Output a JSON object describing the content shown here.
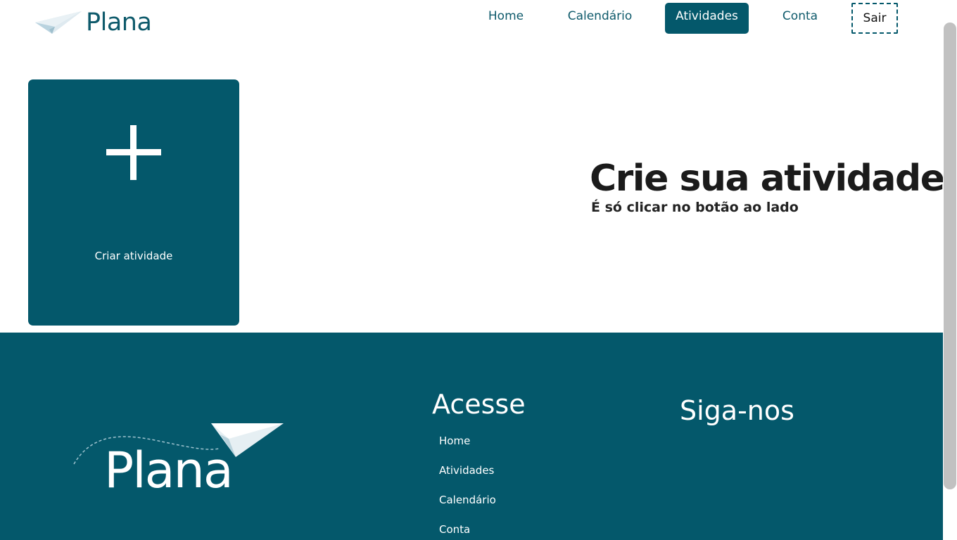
{
  "header": {
    "logo_text": "Plana",
    "nav": {
      "home": "Home",
      "calendario": "Calendário",
      "atividades": "Atividades",
      "conta": "Conta",
      "sair": "Sair"
    }
  },
  "main": {
    "create_card_label": "Criar atividade",
    "hero_title": "Crie sua atividade!",
    "hero_subtitle": "É só clicar no botão ao lado"
  },
  "footer": {
    "logo_text": "Plana",
    "acesse_title": "Acesse",
    "links": [
      "Home",
      "Atividades",
      "Calendário",
      "Conta"
    ],
    "siga_title": "Siga-nos"
  },
  "colors": {
    "brand": "#04586b",
    "text_dark": "#1b1b1b",
    "background": "#ffffff"
  },
  "icons": {
    "header_logo": "paper-plane-icon",
    "create": "plus-icon",
    "footer_logo": "paper-plane-icon"
  }
}
